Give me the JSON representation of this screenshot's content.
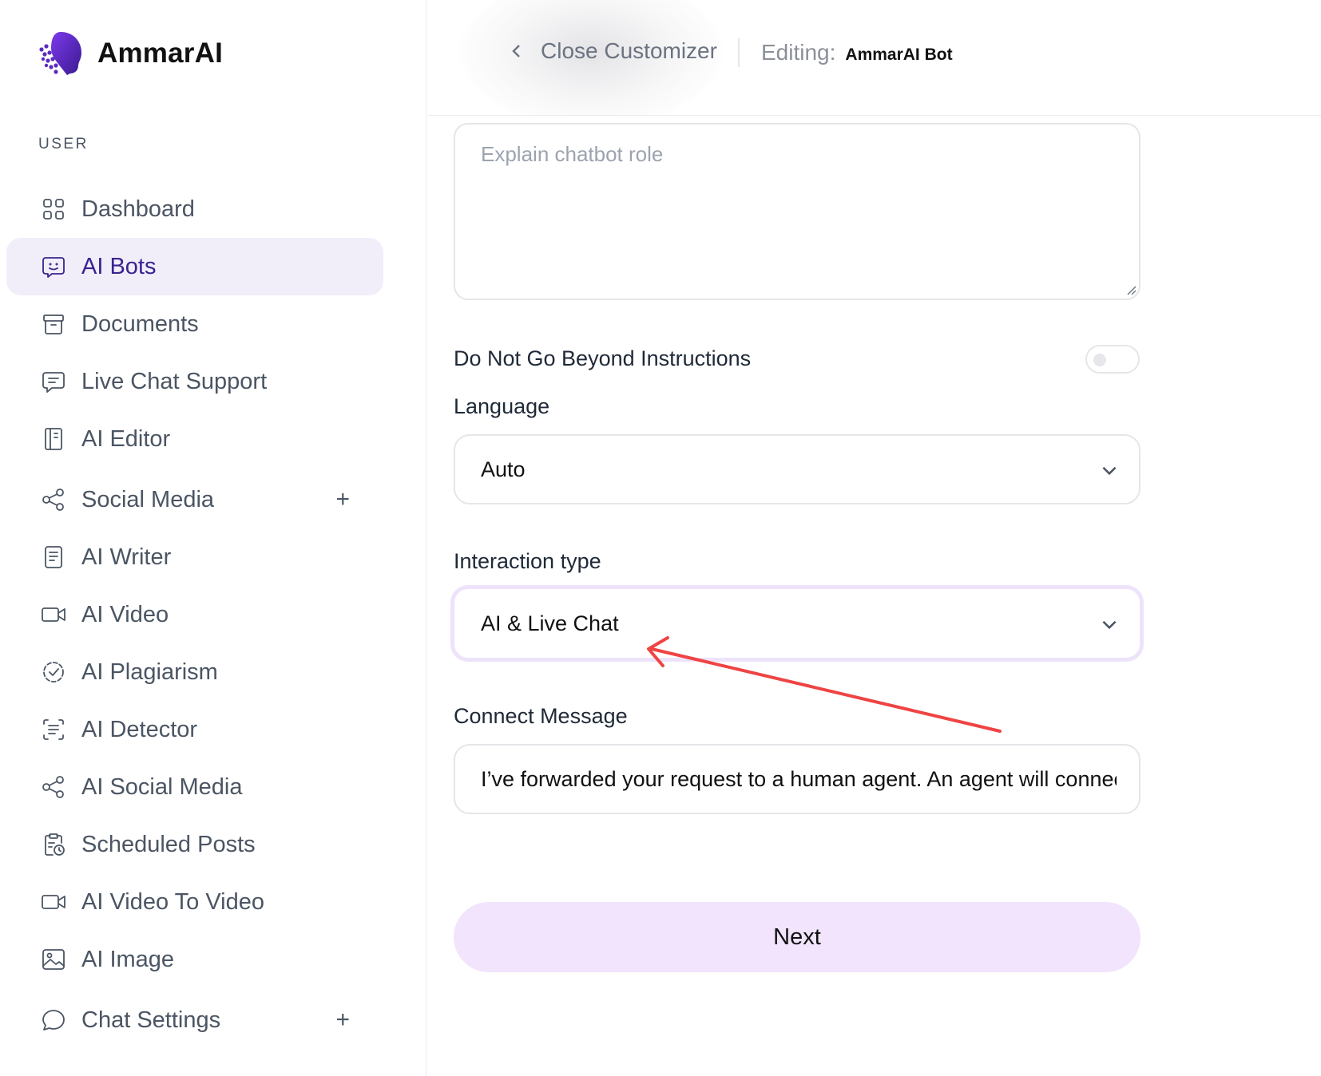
{
  "brand": {
    "name": "AmmarAI",
    "logo_icon": "head-circuit-logo-icon"
  },
  "sidebar": {
    "section_label": "USER",
    "items": [
      {
        "label": "Dashboard",
        "icon": "grid-icon",
        "active": false,
        "expandable": false
      },
      {
        "label": "AI Bots",
        "icon": "chatbot-icon",
        "active": true,
        "expandable": false
      },
      {
        "label": "Documents",
        "icon": "archive-icon",
        "active": false,
        "expandable": false
      },
      {
        "label": "Live Chat Support",
        "icon": "message-icon",
        "active": false,
        "expandable": false
      },
      {
        "label": "AI Editor",
        "icon": "notebook-icon",
        "active": false,
        "expandable": false
      },
      {
        "label": "Social Media",
        "icon": "share-icon",
        "active": false,
        "expandable": true
      },
      {
        "label": "AI Writer",
        "icon": "document-icon",
        "active": false,
        "expandable": false
      },
      {
        "label": "AI Video",
        "icon": "video-icon",
        "active": false,
        "expandable": false
      },
      {
        "label": "AI Plagiarism",
        "icon": "dashed-check-icon",
        "active": false,
        "expandable": false
      },
      {
        "label": "AI Detector",
        "icon": "scan-text-icon",
        "active": false,
        "expandable": false
      },
      {
        "label": "AI Social Media",
        "icon": "share-icon",
        "active": false,
        "expandable": false
      },
      {
        "label": "Scheduled Posts",
        "icon": "clipboard-clock-icon",
        "active": false,
        "expandable": false
      },
      {
        "label": "AI Video To Video",
        "icon": "video-icon",
        "active": false,
        "expandable": false
      },
      {
        "label": "AI Image",
        "icon": "image-icon",
        "active": false,
        "expandable": false
      },
      {
        "label": "Chat Settings",
        "icon": "chat-bubble-icon",
        "active": false,
        "expandable": true
      }
    ],
    "expand_symbol": "+"
  },
  "header": {
    "close_label": "Close Customizer",
    "editing_key": "Editing:",
    "editing_value": "AmmarAI Bot"
  },
  "form": {
    "role_placeholder": "Explain chatbot role",
    "role_value": "",
    "toggle_label": "Do Not Go Beyond Instructions",
    "toggle_on": false,
    "language_label": "Language",
    "language_value": "Auto",
    "interaction_label": "Interaction type",
    "interaction_value": "AI & Live Chat",
    "connect_label": "Connect Message",
    "connect_value": "I’ve forwarded your request to a human agent. An agent will connect with you as soon as possible.",
    "next_label": "Next"
  },
  "colors": {
    "accent": "#3b2290",
    "active_bg": "#f1eefa",
    "button_bg": "#f1e4fc",
    "focus_ring": "#ede3fb",
    "annotation_arrow": "#ef4444"
  }
}
